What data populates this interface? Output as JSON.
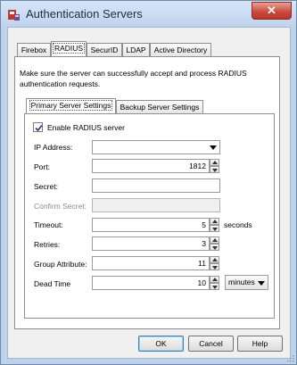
{
  "window": {
    "title": "Authentication Servers",
    "close_glyph": "✕",
    "icons": {
      "app": "authentication-servers-app-icon",
      "close": "close-icon",
      "grip": "resize-grip-icon"
    }
  },
  "tabs": [
    "Firebox",
    "RADIUS",
    "SecurID",
    "LDAP",
    "Active Directory"
  ],
  "active_tab": "RADIUS",
  "description": "Make sure the server can successfully accept and process RADIUS authentication requests.",
  "subtabs": [
    "Primary Server Settings",
    "Backup Server Settings"
  ],
  "active_subtab": "Primary Server Settings",
  "form": {
    "enable_label": "Enable RADIUS server",
    "enable_checked": true,
    "ip_address": {
      "label": "IP Address:",
      "value": ""
    },
    "port": {
      "label": "Port:",
      "value": "1812"
    },
    "secret": {
      "label": "Secret:",
      "value": ""
    },
    "confirm_secret": {
      "label": "Confirm Secret:",
      "value": ""
    },
    "timeout": {
      "label": "Timeout:",
      "value": "5",
      "unit": "seconds"
    },
    "retries": {
      "label": "Retries:",
      "value": "3"
    },
    "group_attribute": {
      "label": "Group Attribute:",
      "value": "11"
    },
    "dead_time": {
      "label": "Dead Time",
      "value": "10",
      "unit": "minutes"
    }
  },
  "buttons": {
    "ok": "OK",
    "cancel": "Cancel",
    "help": "Help"
  }
}
